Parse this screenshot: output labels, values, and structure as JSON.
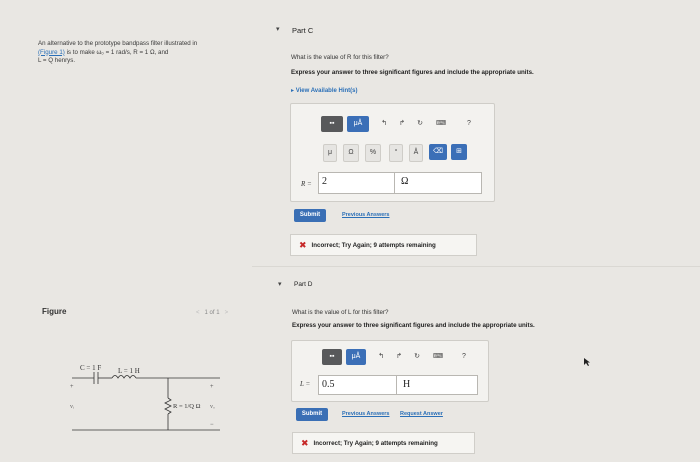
{
  "problem": {
    "line1": "An alternative to the prototype bandpass filter illustrated in",
    "link": "(Figure 1)",
    "line2": "is to make ω₀ = 1 rad/s, R = 1 Ω, and",
    "line3": "L = Q henrys."
  },
  "figure": {
    "label": "Figure",
    "pager": "1 of 1",
    "c_label": "C = 1 F",
    "l_label": "L = 1 H",
    "r_label": "R = 1/Q Ω",
    "vi_label": "vᵢ",
    "vo_label": "vₒ",
    "plus": "+",
    "minus": "−"
  },
  "part_c": {
    "title": "Part C",
    "question": "What is the value of R for this filter?",
    "instruction": "Express your answer to three significant figures and include the appropriate units.",
    "hint": "View Available Hint(s)",
    "var_label": "R =",
    "value": "2",
    "unit": "Ω",
    "submit": "Submit",
    "previous_answers": "Previous Answers",
    "feedback": "Incorrect; Try Again; 9 attempts remaining",
    "tools": [
      "μÅ",
      "↰",
      "↱",
      "↻",
      "⌨",
      "?",
      "μ",
      "Ω",
      "%",
      "°",
      "Å",
      "⌫",
      "⊞"
    ]
  },
  "part_d": {
    "title": "Part D",
    "question": "What is the value of L for this filter?",
    "instruction": "Express your answer to three significant figures and include the appropriate units.",
    "var_label": "L =",
    "value": "0.5",
    "unit": "H",
    "submit": "Submit",
    "previous_answers": "Previous Answers",
    "request_answer": "Request Answer",
    "feedback": "Incorrect; Try Again; 9 attempts remaining",
    "tools": [
      "μÅ",
      "↰",
      "↱",
      "↻",
      "⌨",
      "?"
    ]
  },
  "colors": {
    "accent": "#3a6fb5",
    "error": "#c62828",
    "toolbar_dark": "#58595b"
  }
}
